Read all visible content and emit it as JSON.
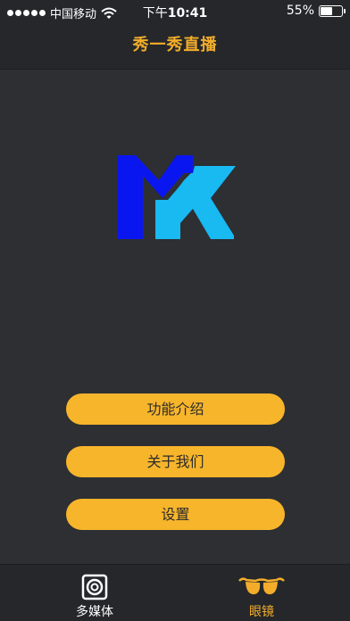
{
  "status_bar": {
    "carrier": "中国移动",
    "time_prefix": "下午",
    "time": "10:41",
    "battery_percent": "55%",
    "battery_level": 0.55,
    "signal_dots": 5
  },
  "nav": {
    "title": "秀一秀直播"
  },
  "logo": {
    "icon": "mk-logo",
    "colors": {
      "m": "#0a16f0",
      "k": "#19b9f2"
    }
  },
  "menu": [
    {
      "label": "功能介绍"
    },
    {
      "label": "关于我们"
    },
    {
      "label": "设置"
    }
  ],
  "tabs": [
    {
      "label": "多媒体",
      "icon": "speaker-icon",
      "active": false
    },
    {
      "label": "眼镜",
      "icon": "sunglasses-icon",
      "active": true
    }
  ],
  "colors": {
    "accent": "#f3ad2a",
    "button": "#f7b52b",
    "background": "#2d2f33",
    "bar": "#25272a"
  }
}
